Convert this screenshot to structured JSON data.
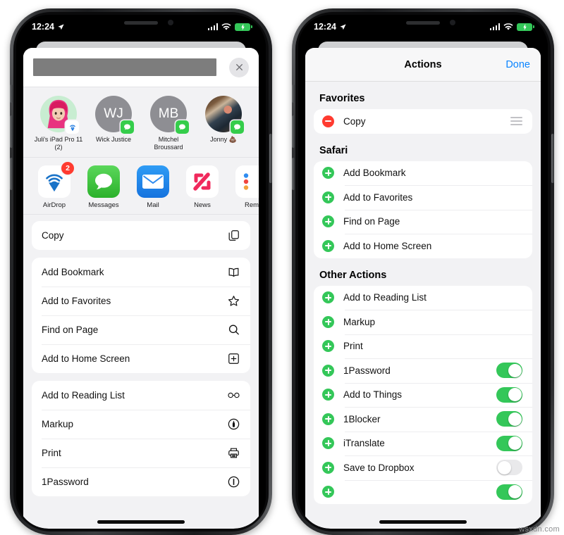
{
  "watermark": "wsxdn.com",
  "status_bar": {
    "time": "12:24",
    "location_icon": "location-arrow-icon",
    "cellular_icon": "cellular-bars-icon",
    "wifi_icon": "wifi-icon",
    "battery_icon": "battery-charging-icon"
  },
  "left_phone": {
    "share_sheet": {
      "redacted_title": "",
      "close_label": "close-icon",
      "contacts": [
        {
          "name": "Juli's iPad Pro 11 (2)",
          "initials": "",
          "kind": "memoji",
          "badge": "airdrop"
        },
        {
          "name": "Wick Justice",
          "initials": "WJ",
          "kind": "initials",
          "badge": "messages"
        },
        {
          "name": "Mitchel Broussard",
          "initials": "MB",
          "kind": "initials",
          "badge": "messages"
        },
        {
          "name": "Jonny 💩",
          "initials": "",
          "kind": "photo",
          "badge": "messages"
        }
      ],
      "apps": [
        {
          "name": "AirDrop",
          "icon": "airdrop-icon",
          "badge": "2"
        },
        {
          "name": "Messages",
          "icon": "messages-icon",
          "badge": ""
        },
        {
          "name": "Mail",
          "icon": "mail-icon",
          "badge": ""
        },
        {
          "name": "News",
          "icon": "news-icon",
          "badge": ""
        },
        {
          "name": "Rem",
          "icon": "reminders-icon",
          "badge": ""
        }
      ],
      "action_groups": [
        {
          "rows": [
            {
              "label": "Copy",
              "icon": "copy-icon"
            }
          ]
        },
        {
          "rows": [
            {
              "label": "Add Bookmark",
              "icon": "book-icon"
            },
            {
              "label": "Add to Favorites",
              "icon": "star-icon"
            },
            {
              "label": "Find on Page",
              "icon": "search-icon"
            },
            {
              "label": "Add to Home Screen",
              "icon": "plus-square-icon"
            }
          ]
        },
        {
          "rows": [
            {
              "label": "Add to Reading List",
              "icon": "glasses-icon"
            },
            {
              "label": "Markup",
              "icon": "markup-pen-icon"
            },
            {
              "label": "Print",
              "icon": "printer-icon"
            },
            {
              "label": "1Password",
              "icon": "1password-icon"
            }
          ]
        }
      ]
    }
  },
  "right_phone": {
    "nav": {
      "title": "Actions",
      "done_label": "Done"
    },
    "sections": [
      {
        "title": "Favorites",
        "rows": [
          {
            "label": "Copy",
            "control": "minus",
            "accessory": "reorder"
          }
        ]
      },
      {
        "title": "Safari",
        "rows": [
          {
            "label": "Add Bookmark",
            "control": "plus",
            "accessory": "none"
          },
          {
            "label": "Add to Favorites",
            "control": "plus",
            "accessory": "none"
          },
          {
            "label": "Find on Page",
            "control": "plus",
            "accessory": "none"
          },
          {
            "label": "Add to Home Screen",
            "control": "plus",
            "accessory": "none"
          }
        ]
      },
      {
        "title": "Other Actions",
        "rows": [
          {
            "label": "Add to Reading List",
            "control": "plus",
            "accessory": "none"
          },
          {
            "label": "Markup",
            "control": "plus",
            "accessory": "none"
          },
          {
            "label": "Print",
            "control": "plus",
            "accessory": "none"
          },
          {
            "label": "1Password",
            "control": "plus",
            "accessory": "toggle",
            "toggle_on": true
          },
          {
            "label": "Add to Things",
            "control": "plus",
            "accessory": "toggle",
            "toggle_on": true
          },
          {
            "label": "1Blocker",
            "control": "plus",
            "accessory": "toggle",
            "toggle_on": true
          },
          {
            "label": "iTranslate",
            "control": "plus",
            "accessory": "toggle",
            "toggle_on": true
          },
          {
            "label": "Save to Dropbox",
            "control": "plus",
            "accessory": "toggle",
            "toggle_on": false
          }
        ]
      }
    ]
  },
  "colors": {
    "accent_blue": "#0a84ff",
    "green": "#34c759",
    "red": "#ff3b30",
    "sheet_bg": "#f2f2f4"
  }
}
